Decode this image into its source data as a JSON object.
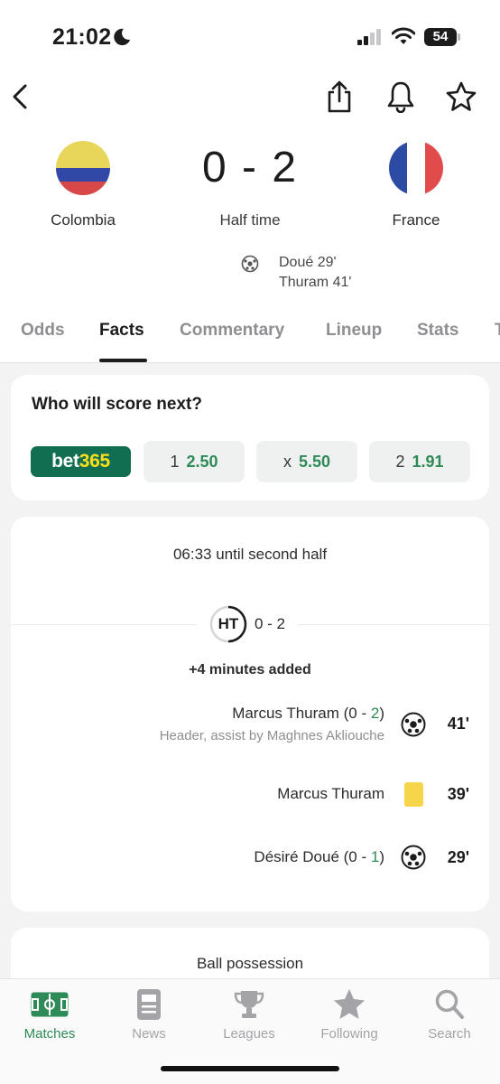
{
  "status_bar": {
    "time": "21:02",
    "battery": "54"
  },
  "match": {
    "home_team": "Colombia",
    "away_team": "France",
    "score": "0 - 2",
    "status": "Half time",
    "scorers": [
      "Doué 29'",
      "Thuram 41'"
    ]
  },
  "tabs": [
    "Odds",
    "Facts",
    "Commentary",
    "Lineup",
    "Stats",
    "T"
  ],
  "active_tab": "Facts",
  "odds": {
    "title": "Who will score next?",
    "bookmaker_a": "bet",
    "bookmaker_b": "365",
    "options": [
      {
        "key": "1",
        "value": "2.50"
      },
      {
        "key": "x",
        "value": "5.50"
      },
      {
        "key": "2",
        "value": "1.91"
      }
    ]
  },
  "facts": {
    "countdown": "06:33 until second half",
    "ht_badge": "HT",
    "ht_score": "0 - 2",
    "added_time": "+4 minutes added",
    "events": [
      {
        "player": "Marcus Thuram (0 - ",
        "score_hl": "2",
        "close": ")",
        "detail": "Header, assist by Maghnes Akliouche",
        "minute": "41'",
        "type": "goal"
      },
      {
        "player": "Marcus Thuram",
        "minute": "39'",
        "type": "yellow-card"
      },
      {
        "player": "Désiré Doué (0 - ",
        "score_hl": "1",
        "close": ")",
        "minute": "29'",
        "type": "goal"
      }
    ]
  },
  "possession": {
    "label": "Ball possession"
  },
  "bottom_nav": [
    "Matches",
    "News",
    "Leagues",
    "Following",
    "Search"
  ],
  "colors": {
    "accent": "#2e8a57",
    "bet365": "#126e51",
    "bet365_yellow": "#ffdf1b",
    "yellow_card": "#f7d54a"
  }
}
